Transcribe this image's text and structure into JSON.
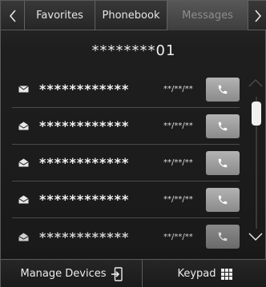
{
  "tabs": [
    {
      "label": "Favorites",
      "active": false
    },
    {
      "label": "Phonebook",
      "active": false
    },
    {
      "label": "Messages",
      "active": true
    }
  ],
  "contact": {
    "name": "********01"
  },
  "messages": [
    {
      "icon": "envelope-closed-icon",
      "sender": "************",
      "date": "**/**/**"
    },
    {
      "icon": "envelope-open-icon",
      "sender": "************",
      "date": "**/**/**"
    },
    {
      "icon": "envelope-open-icon",
      "sender": "************",
      "date": "**/**/**"
    },
    {
      "icon": "envelope-open-icon",
      "sender": "************",
      "date": "**/**/**"
    },
    {
      "icon": "envelope-open-icon",
      "sender": "************",
      "date": "**/**/**"
    }
  ],
  "bottom": {
    "manage_devices_label": "Manage Devices",
    "keypad_label": "Keypad"
  },
  "colors": {
    "background": "#1a1a1a",
    "call_button": "#9e9e9e",
    "active_tab_text": "#8d8d8d"
  }
}
